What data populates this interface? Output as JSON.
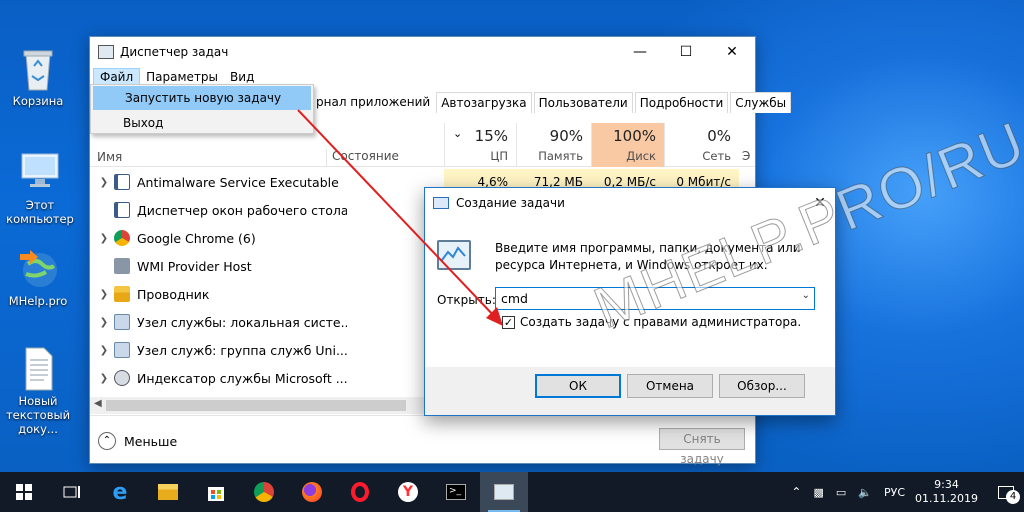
{
  "desktop": {
    "icons": [
      {
        "label": "Корзина"
      },
      {
        "label": "Этот компьютер"
      },
      {
        "label": "MHelp.pro"
      },
      {
        "label": "Новый текстовый доку..."
      }
    ]
  },
  "task_manager": {
    "title": "Диспетчер задач",
    "menu": [
      "Файл",
      "Параметры",
      "Вид"
    ],
    "file_menu": [
      "Запустить новую задачу",
      "Выход"
    ],
    "tabs": [
      "рнал приложений",
      "Автозагрузка",
      "Пользователи",
      "Подробности",
      "Службы"
    ],
    "columns": {
      "name": "Имя",
      "state": "Состояние",
      "cpu": {
        "pct": "15%",
        "label": "ЦП"
      },
      "mem": {
        "pct": "90%",
        "label": "Память"
      },
      "disk": {
        "pct": "100%",
        "label": "Диск"
      },
      "net": {
        "pct": "0%",
        "label": "Сеть"
      },
      "extra": "Э"
    },
    "processes": [
      {
        "name": "Antimalware Service Executable",
        "cpu": "4,6%",
        "mem": "71,2 МБ",
        "disk": "0,2 МБ/с",
        "net": "0 Мбит/с"
      },
      {
        "name": "Диспетчер окон рабочего стола"
      },
      {
        "name": "Google Chrome (6)"
      },
      {
        "name": "WMI Provider Host"
      },
      {
        "name": "Проводник"
      },
      {
        "name": "Узел службы: локальная систе..."
      },
      {
        "name": "Узел служб: группа служб Uni..."
      },
      {
        "name": "Индексатор службы Microsoft ..."
      }
    ],
    "less_label": "Меньше",
    "end_task": "Снять задачу"
  },
  "run_dialog": {
    "title": "Создание задачи",
    "description": "Введите имя программы, папки, документа или ресурса Интернета, и Windows откроет их.",
    "open_label": "Открыть:",
    "input_value": "cmd",
    "admin_checkbox_label": "Создать задачу с правами администратора.",
    "admin_checked": true,
    "ok": "ОК",
    "cancel": "Отмена",
    "browse": "Обзор..."
  },
  "taskbar": {
    "lang": "РУС",
    "time": "9:34",
    "date": "01.11.2019",
    "notifications": "4"
  },
  "watermark": "MHELP.PRO/RU",
  "colors": {
    "accent": "#0078d7",
    "desktop": "#0a63c9",
    "disk_highlight": "#f9c9a4",
    "annotation": "#e02020"
  }
}
